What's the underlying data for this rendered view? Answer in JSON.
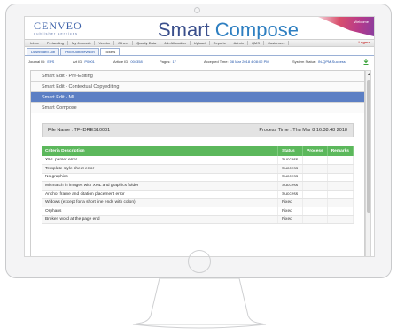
{
  "app": {
    "brand_logo": "CENVEO",
    "brand_tagline": "publisher services",
    "title_part1": "Smart ",
    "title_part2": "Compose",
    "user_name": "Welcome",
    "logout_label": "Logout"
  },
  "nav": {
    "items": [
      "Inbox",
      "Prelanding",
      "My Journals",
      "Vendor",
      "Others",
      "Quality Data",
      "Job Allocation",
      "Upload",
      "Reports",
      "Admin",
      "QMS",
      "Customers"
    ]
  },
  "tabs": {
    "items": [
      "Dashboard Job",
      "Proof Job/Revision",
      "Tickets"
    ]
  },
  "info": {
    "journal_id_label": "Journal ID:",
    "journal_id": "EPS",
    "article_id_label": "Art ID:",
    "article_id": "P0001",
    "article_no_label": "Article ID:",
    "article_no": "004358",
    "pages_label": "Pages:",
    "pages": "17",
    "accepted_label": "Accepted Time:",
    "accepted": "08 Mar 2018 4:08:02 PM",
    "system_label": "System Status:",
    "system_status": "IN-QPM-Success"
  },
  "accordion": {
    "items": [
      {
        "label": "Smart Edit - Pre-Editing",
        "selected": false
      },
      {
        "label": "Smart Edit - Contextual Copyediting",
        "selected": false
      },
      {
        "label": "Smart Edit - ML",
        "selected": true
      },
      {
        "label": "Smart Compose",
        "selected": false
      }
    ]
  },
  "file": {
    "name": "File Name : TF-IDRES10001",
    "process_time": "Process Time : Thu Mar 8 16:38:48 2018"
  },
  "table": {
    "headers": [
      "Criteria Description",
      "Status",
      "Process",
      "Remarks"
    ],
    "rows": [
      {
        "desc": "XML parser error",
        "status": "Success"
      },
      {
        "desc": "Template style sheet error",
        "status": "Success"
      },
      {
        "desc": "No graphics",
        "status": "Success"
      },
      {
        "desc": "Mismatch in images with XML and graphics folder",
        "status": "Success"
      },
      {
        "desc": "Anchor frame and citation placement error",
        "status": "Success"
      },
      {
        "desc": "Widows (except for a short line ends with colon)",
        "status": "Fixed"
      },
      {
        "desc": "Orphans",
        "status": "Fixed"
      },
      {
        "desc": "Broken word at the page end",
        "status": "Fixed"
      }
    ]
  },
  "colors": {
    "selected_row": "#5c7fc4",
    "table_header": "#5cb85c",
    "title": "#3a4f8c"
  }
}
